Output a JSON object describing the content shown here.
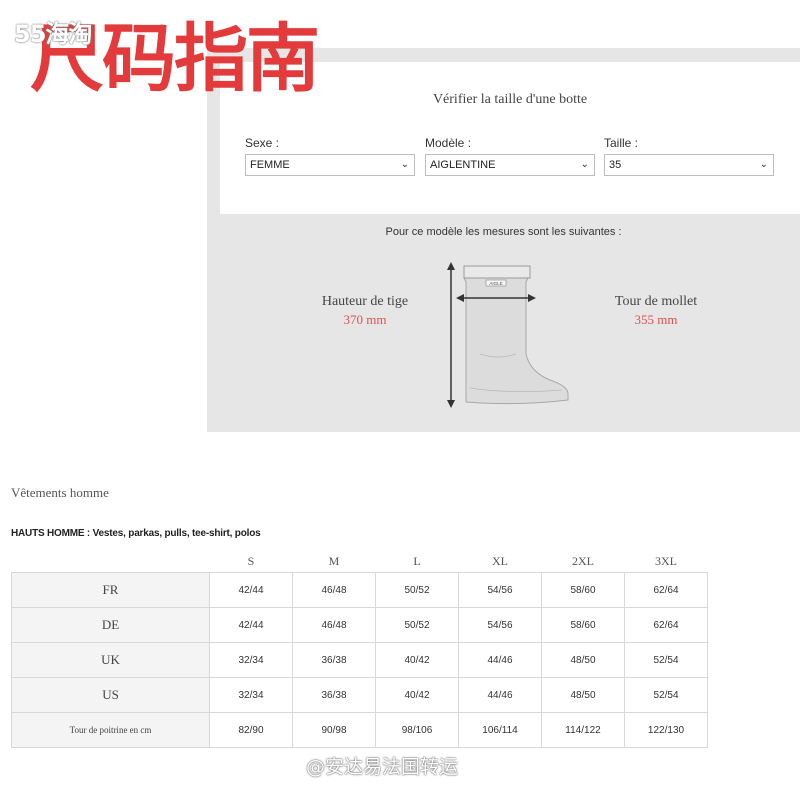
{
  "watermark_top": "55海淘",
  "headline": "尺码指南",
  "boot_checker": {
    "title": "Vérifier la taille d'une botte",
    "fields": [
      {
        "label": "Sexe :",
        "value": "FEMME"
      },
      {
        "label": "Modèle :",
        "value": "AIGLENTINE"
      },
      {
        "label": "Taille :",
        "value": "35"
      }
    ],
    "caption": "Pour ce modèle les mesures sont les suivantes :",
    "shaft_height": {
      "label": "Hauteur de tige",
      "value": "370 mm"
    },
    "calf_circumference": {
      "label": "Tour de mollet",
      "value": "355 mm"
    },
    "boot_brand": "AIGLE",
    "accent_color": "#d9534f"
  },
  "size_section": {
    "title": "Vêtements homme",
    "subtitle": "HAUTS HOMME : Vestes, parkas, pulls, tee-shirt, polos",
    "columns": [
      "S",
      "M",
      "L",
      "XL",
      "2XL",
      "3XL"
    ],
    "rows": [
      {
        "label": "FR",
        "values": [
          "42/44",
          "46/48",
          "50/52",
          "54/56",
          "58/60",
          "62/64"
        ]
      },
      {
        "label": "DE",
        "values": [
          "42/44",
          "46/48",
          "50/52",
          "54/56",
          "58/60",
          "62/64"
        ]
      },
      {
        "label": "UK",
        "values": [
          "32/34",
          "36/38",
          "40/42",
          "44/46",
          "48/50",
          "52/54"
        ]
      },
      {
        "label": "US",
        "values": [
          "32/34",
          "36/38",
          "40/42",
          "44/46",
          "48/50",
          "52/54"
        ]
      },
      {
        "label": "Tour de poitrine en cm",
        "values": [
          "82/90",
          "90/98",
          "98/106",
          "106/114",
          "114/122",
          "122/130"
        ]
      }
    ]
  },
  "watermark_bottom": "@安达易法国转运"
}
